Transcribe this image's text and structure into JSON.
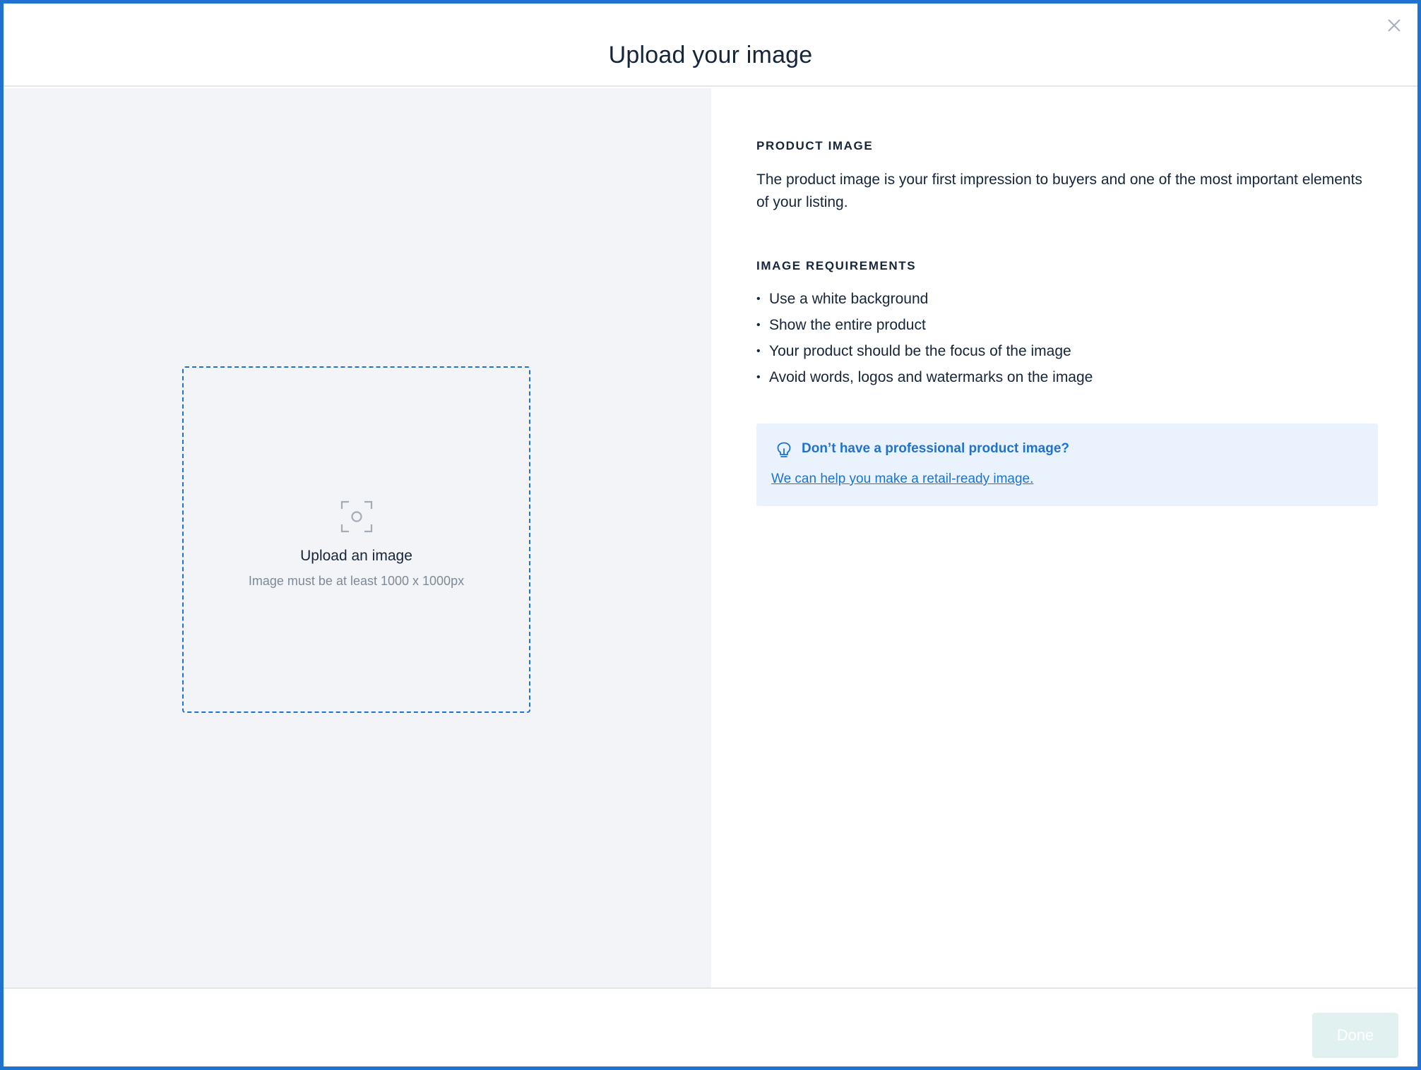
{
  "modal": {
    "title": "Upload your image",
    "close_icon": "close-icon"
  },
  "upload": {
    "icon": "image-focus-icon",
    "label": "Upload an image",
    "hint": "Image must be at least 1000 x 1000px"
  },
  "info": {
    "product_image_heading": "PRODUCT IMAGE",
    "product_image_text": "The product image is your first impression to buyers and one of the most important elements of your listing.",
    "requirements_heading": "IMAGE REQUIREMENTS",
    "requirements": [
      "Use a white background",
      "Show the entire product",
      "Your product should be the focus of the image",
      "Avoid words, logos and watermarks on the image"
    ]
  },
  "tip": {
    "icon": "lightbulb-icon",
    "title": "Don’t have a professional product image?",
    "link": "We can help you make a retail-ready image."
  },
  "footer": {
    "done_label": "Done",
    "done_disabled": true
  },
  "colors": {
    "accent": "#1f72cf",
    "frame_border": "#1f72cf",
    "left_pane_bg": "#f2f4f7",
    "tip_bg": "#eaf3fd",
    "done_disabled_bg": "#e1f1ef"
  }
}
